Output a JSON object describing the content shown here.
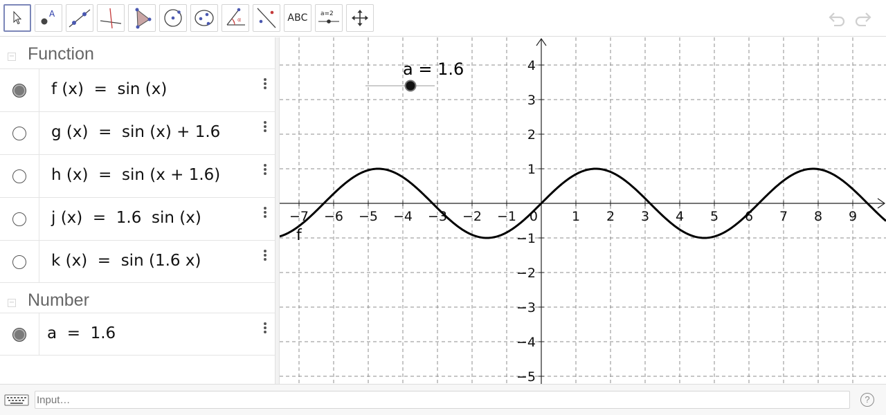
{
  "toolbar": {
    "tools": [
      {
        "name": "move-tool",
        "label": ""
      },
      {
        "name": "point-tool",
        "label": ""
      },
      {
        "name": "line-tool",
        "label": ""
      },
      {
        "name": "perpendicular-line-tool",
        "label": ""
      },
      {
        "name": "polygon-tool",
        "label": ""
      },
      {
        "name": "circle-tool",
        "label": ""
      },
      {
        "name": "ellipse-tool",
        "label": ""
      },
      {
        "name": "angle-tool",
        "label": ""
      },
      {
        "name": "reflect-tool",
        "label": ""
      },
      {
        "name": "text-tool",
        "label": "ABC"
      },
      {
        "name": "slider-tool",
        "label": "a=2"
      },
      {
        "name": "move-graphics-view-tool",
        "label": ""
      }
    ],
    "undo_icon": "undo-icon",
    "redo_icon": "redo-icon"
  },
  "algebra": {
    "groups": [
      {
        "title": "Function",
        "items": [
          {
            "formula": "f (x)  =  sin (x)",
            "visible": true
          },
          {
            "formula": "g (x)  =  sin (x) + 1.6",
            "visible": false
          },
          {
            "formula": "h (x)  =  sin (x + 1.6)",
            "visible": false
          },
          {
            "formula": "j (x)  =  1.6  sin (x)",
            "visible": false
          },
          {
            "formula": "k (x)  =  sin (1.6 x)",
            "visible": false
          }
        ]
      },
      {
        "title": "Number",
        "items": [
          {
            "formula": "a  =  1.6",
            "visible": true
          }
        ]
      }
    ]
  },
  "graphics": {
    "slider_caption": "a = 1.6",
    "slider_value": 1.6,
    "curve_label": "f",
    "x_ticks": [
      "−7",
      "−6",
      "−5",
      "−4",
      "−3",
      "−2",
      "−1",
      "0",
      "1",
      "2",
      "3",
      "4",
      "5",
      "6",
      "7",
      "8",
      "9"
    ],
    "y_ticks": [
      "4",
      "3",
      "2",
      "1",
      "−1",
      "−2",
      "−3",
      "−4",
      "−5"
    ],
    "grid": "dashed",
    "function": "sin(x)"
  },
  "input_bar": {
    "placeholder": "Input…",
    "keyboard_icon": "keyboard-icon",
    "help_label": "?"
  }
}
